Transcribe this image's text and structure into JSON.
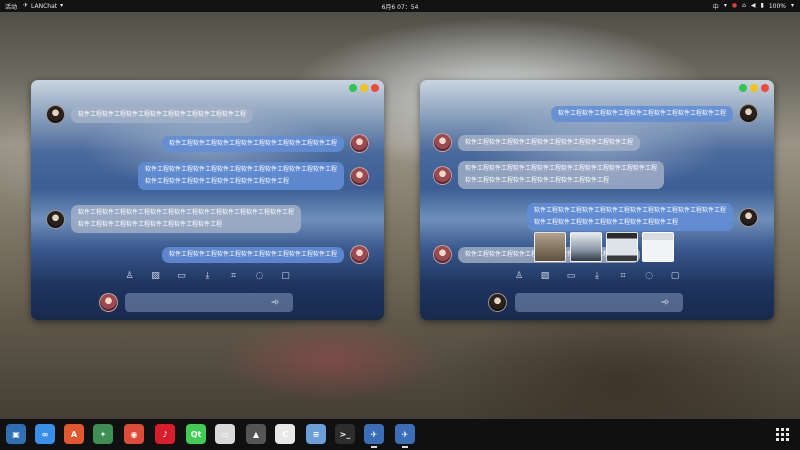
{
  "topbar": {
    "activities": "活动",
    "app_name": "LANChat",
    "clock": "6月6 07：54",
    "input_method": "中",
    "battery": "100%"
  },
  "colors": {
    "bubble_light": "#a5b2c8",
    "bubble_blue": "#628dd6",
    "traffic_green": "#2ec552",
    "traffic_yellow": "#f4c21d",
    "traffic_red": "#f04a3a",
    "dock_bg": "#101010"
  },
  "left_window": {
    "messages": [
      {
        "side": "left",
        "style": "light",
        "lines": [
          "软件工程软件工程软件工程软件工程软件工程软件工程软件工程"
        ]
      },
      {
        "side": "right",
        "style": "blue",
        "lines": [
          "软件工程软件工程软件工程软件工程软件工程软件工程软件工程"
        ]
      },
      {
        "side": "right",
        "style": "blue",
        "lines": [
          "软件工程软件工程软件工程软件工程软件工程软件工程软件工程软件工程",
          "软件工程软件工程软件工程软件工程软件工程软件工程"
        ]
      },
      {
        "side": "left",
        "style": "light",
        "lines": [
          "软件工程软件工程软件工程软件工程软件工程软件工程软件工程软件工程软件工程",
          "软件工程软件工程软件工程软件工程软件工程软件工程"
        ]
      },
      {
        "side": "right",
        "style": "blue",
        "lines": [
          "软件工程软件工程软件工程软件工程软件工程软件工程软件工程"
        ]
      }
    ],
    "input_value": ""
  },
  "right_window": {
    "messages": [
      {
        "side": "right",
        "style": "blue",
        "lines": [
          "软件工程软件工程软件工程软件工程软件工程软件工程软件工程"
        ]
      },
      {
        "side": "left",
        "style": "light",
        "lines": [
          "软件工程软件工程软件工程软件工程软件工程软件工程软件工程"
        ]
      },
      {
        "side": "left",
        "style": "light",
        "lines": [
          "软件工程软件工程软件工程软件工程软件工程软件工程软件工程软件工程",
          "软件工程软件工程软件工程软件工程软件工程软件工程"
        ]
      },
      {
        "side": "right",
        "style": "blue",
        "lines": [
          "软件工程软件工程软件工程软件工程软件工程软件工程软件工程软件工程",
          "软件工程软件工程软件工程软件工程软件工程软件工程"
        ]
      },
      {
        "side": "left",
        "style": "light",
        "lines": [
          "软件工程软件工程软件工程软件工程软件工程软件工程软件工程"
        ]
      }
    ],
    "input_value": ""
  },
  "toolbar_icons": [
    "user-icon",
    "image-icon",
    "folder-icon",
    "download-icon",
    "crop-icon",
    "chat-icon",
    "screen-share-icon"
  ],
  "dock_apps": [
    {
      "name": "virtualbox-icon",
      "glyph": "▣",
      "color": "#2f6fb3"
    },
    {
      "name": "baidu-netdisk-icon",
      "glyph": "∞",
      "color": "#3a8fe8"
    },
    {
      "name": "app-store-icon",
      "glyph": "A",
      "color": "#e4572e"
    },
    {
      "name": "android-studio-icon",
      "glyph": "✦",
      "color": "#3f8f55"
    },
    {
      "name": "chrome-icon",
      "glyph": "◉",
      "color": "#dd4b39"
    },
    {
      "name": "netease-music-icon",
      "glyph": "♪",
      "color": "#d81e2a"
    },
    {
      "name": "qt-creator-icon",
      "glyph": "Qt",
      "color": "#41cd52"
    },
    {
      "name": "files-icon",
      "glyph": "▭",
      "color": "#d9d9d9"
    },
    {
      "name": "inkscape-icon",
      "glyph": "▲",
      "color": "#555555"
    },
    {
      "name": "clion-icon",
      "glyph": "C",
      "color": "#e8e8e8"
    },
    {
      "name": "text-editor-icon",
      "glyph": "≡",
      "color": "#6a9fd8"
    },
    {
      "name": "terminal-icon",
      "glyph": ">_",
      "color": "#2d2d2d"
    },
    {
      "name": "lanchat-icon-1",
      "glyph": "✈",
      "color": "#3a6fb8"
    },
    {
      "name": "lanchat-icon-2",
      "glyph": "✈",
      "color": "#3a6fb8"
    }
  ]
}
